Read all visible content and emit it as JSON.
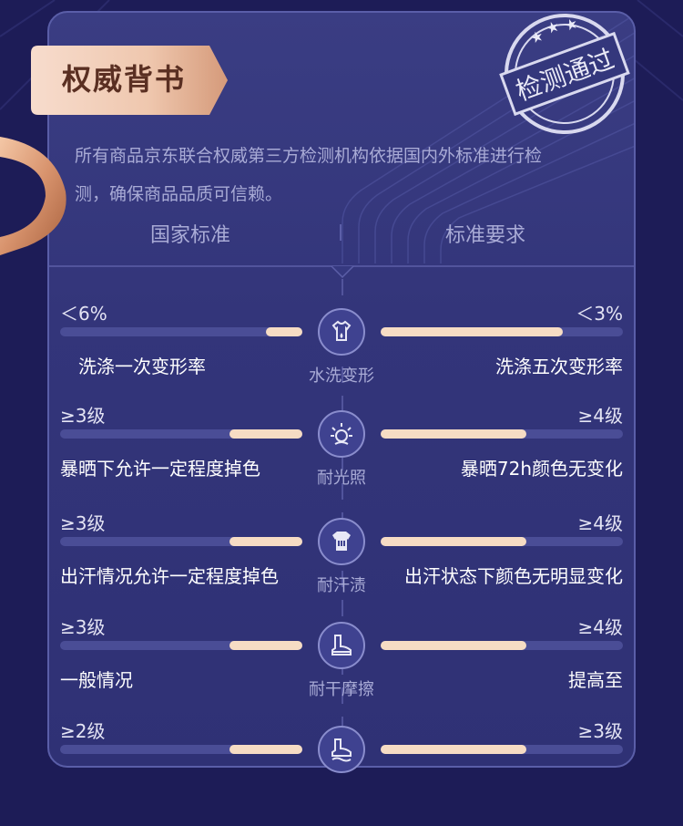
{
  "section": {
    "title": "权威背书",
    "stamp_text": "检测通过",
    "description_line1": "所有商品京东联合权威第三方检测机构依据国内外标准进行检",
    "description_line2": "测，确保商品品质可信赖。"
  },
  "columns": {
    "left": "国家标准",
    "right": "标准要求"
  },
  "rows": [
    {
      "left_value": "＜6%",
      "right_value": "＜3%",
      "left_desc": "洗涤一次变形率",
      "right_desc": "洗涤五次变形率",
      "icon_name": "washing-shirt-icon",
      "icon_label": "水洗变形",
      "left_fill": 0.15,
      "right_fill": 0.75
    },
    {
      "left_value": "≥3级",
      "right_value": "≥4级",
      "left_desc": "暴晒下允许一定程度掉色",
      "right_desc": "暴晒72h颜色无变化",
      "icon_name": "sun-icon",
      "icon_label": "耐光照",
      "left_fill": 0.3,
      "right_fill": 0.6
    },
    {
      "left_value": "≥3级",
      "right_value": "≥4级",
      "left_desc": "出汗情况允许一定程度掉色",
      "right_desc": "出汗状态下颜色无明显变化",
      "icon_name": "sweat-shirt-icon",
      "icon_label": "耐汗渍",
      "left_fill": 0.3,
      "right_fill": 0.6
    },
    {
      "left_value": "≥3级",
      "right_value": "≥4级",
      "left_desc": "一般情况",
      "right_desc": "提高至",
      "icon_name": "shoe-icon",
      "icon_label": "耐干摩擦",
      "left_fill": 0.3,
      "right_fill": 0.6
    },
    {
      "left_value": "≥2级",
      "right_value": "≥3级",
      "left_desc": "",
      "right_desc": "",
      "icon_name": "shoe-wet-icon",
      "icon_label": "",
      "left_fill": 0.3,
      "right_fill": 0.6
    }
  ],
  "colors": {
    "background": "#1d1c57",
    "card": "#363980",
    "bar_track": "#4a4d96",
    "bar_fill": "#f6dcc4",
    "tag_gradient_light": "#f7dccd",
    "tag_gradient_dark": "#c98d6e",
    "ribbon": "#e0a27c"
  }
}
